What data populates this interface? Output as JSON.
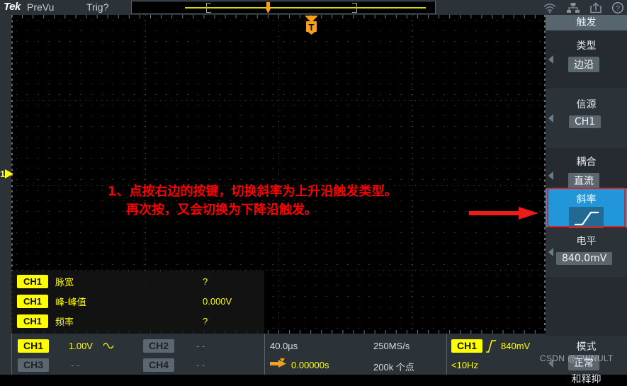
{
  "header": {
    "logo": "Tek",
    "prevu": "PreVu",
    "trig_status": "Trig?",
    "icons": [
      "wifi-icon",
      "network-icon",
      "share-icon",
      "help-icon"
    ]
  },
  "plot": {
    "channel_marker": "1",
    "trigger_marker": "T"
  },
  "annotation": {
    "line1": "1、点按右边的按键，切换斜率为上升沿触发类型。",
    "line2": "再次按，又会切换为下降沿触发。",
    "color": "#ff0000",
    "arrow": "right-arrow"
  },
  "measurements": [
    {
      "source": "CH1",
      "label": "脉宽",
      "value": "?"
    },
    {
      "source": "CH1",
      "label": "峰-峰值",
      "value": "0.000V"
    },
    {
      "source": "CH1",
      "label": "频率",
      "value": "?"
    }
  ],
  "bottom_bar": {
    "channels": [
      {
        "name": "CH1",
        "value": "1.00V",
        "coupling_icon": "ac-sine-icon",
        "active": true
      },
      {
        "name": "CH2",
        "value": "- -",
        "active": false
      },
      {
        "name": "CH3",
        "value": "- -",
        "active": false
      },
      {
        "name": "CH4",
        "value": "- -",
        "active": false
      }
    ],
    "timebase": "40.0µs",
    "horiz_position": "0.00000s",
    "sample_rate": "250MS/s",
    "record_length": "200k 个点",
    "trigger_source": "CH1",
    "trigger_slope_icon": "rising-edge-icon",
    "trigger_level": "840mV",
    "trigger_freq": "<10Hz"
  },
  "sidebar": {
    "title": "触发",
    "sections": [
      {
        "label": "类型",
        "value": "边沿"
      },
      {
        "label": "信源",
        "value": "CH1"
      },
      {
        "label": "耦合",
        "value": "直流"
      }
    ],
    "slope": {
      "label": "斜率",
      "icon": "rising-edge-icon",
      "highlighted": true,
      "accent": "#2196d9"
    },
    "level": {
      "label": "电平",
      "value": "840.0mV"
    },
    "mode": {
      "label": "模式",
      "value": "正常"
    },
    "holdoff": {
      "label": "和释抑"
    }
  },
  "watermark": "CSDN @CWNULT"
}
